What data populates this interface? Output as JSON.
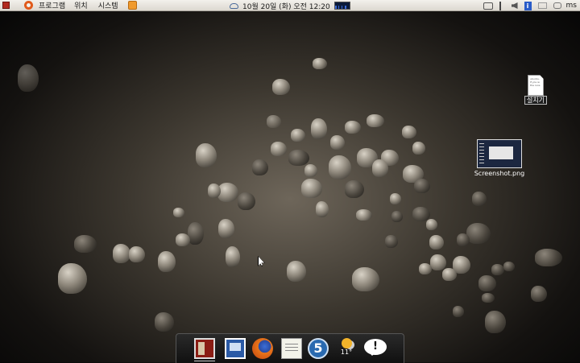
{
  "top_panel": {
    "menus": {
      "applications": "프로그램",
      "places": "위치",
      "system": "시스템"
    },
    "clock": "10월 20일 (화) 오전 12:20",
    "user": "ms"
  },
  "desktop": {
    "icons": [
      {
        "label": "설치기",
        "file_text": [
          "ubuntu-",
          "If you w",
          "the runs"
        ]
      },
      {
        "label": "Screenshot.png"
      }
    ]
  },
  "dock": {
    "weather_temp": "11°",
    "five_label": "5",
    "chat_label": "!"
  }
}
